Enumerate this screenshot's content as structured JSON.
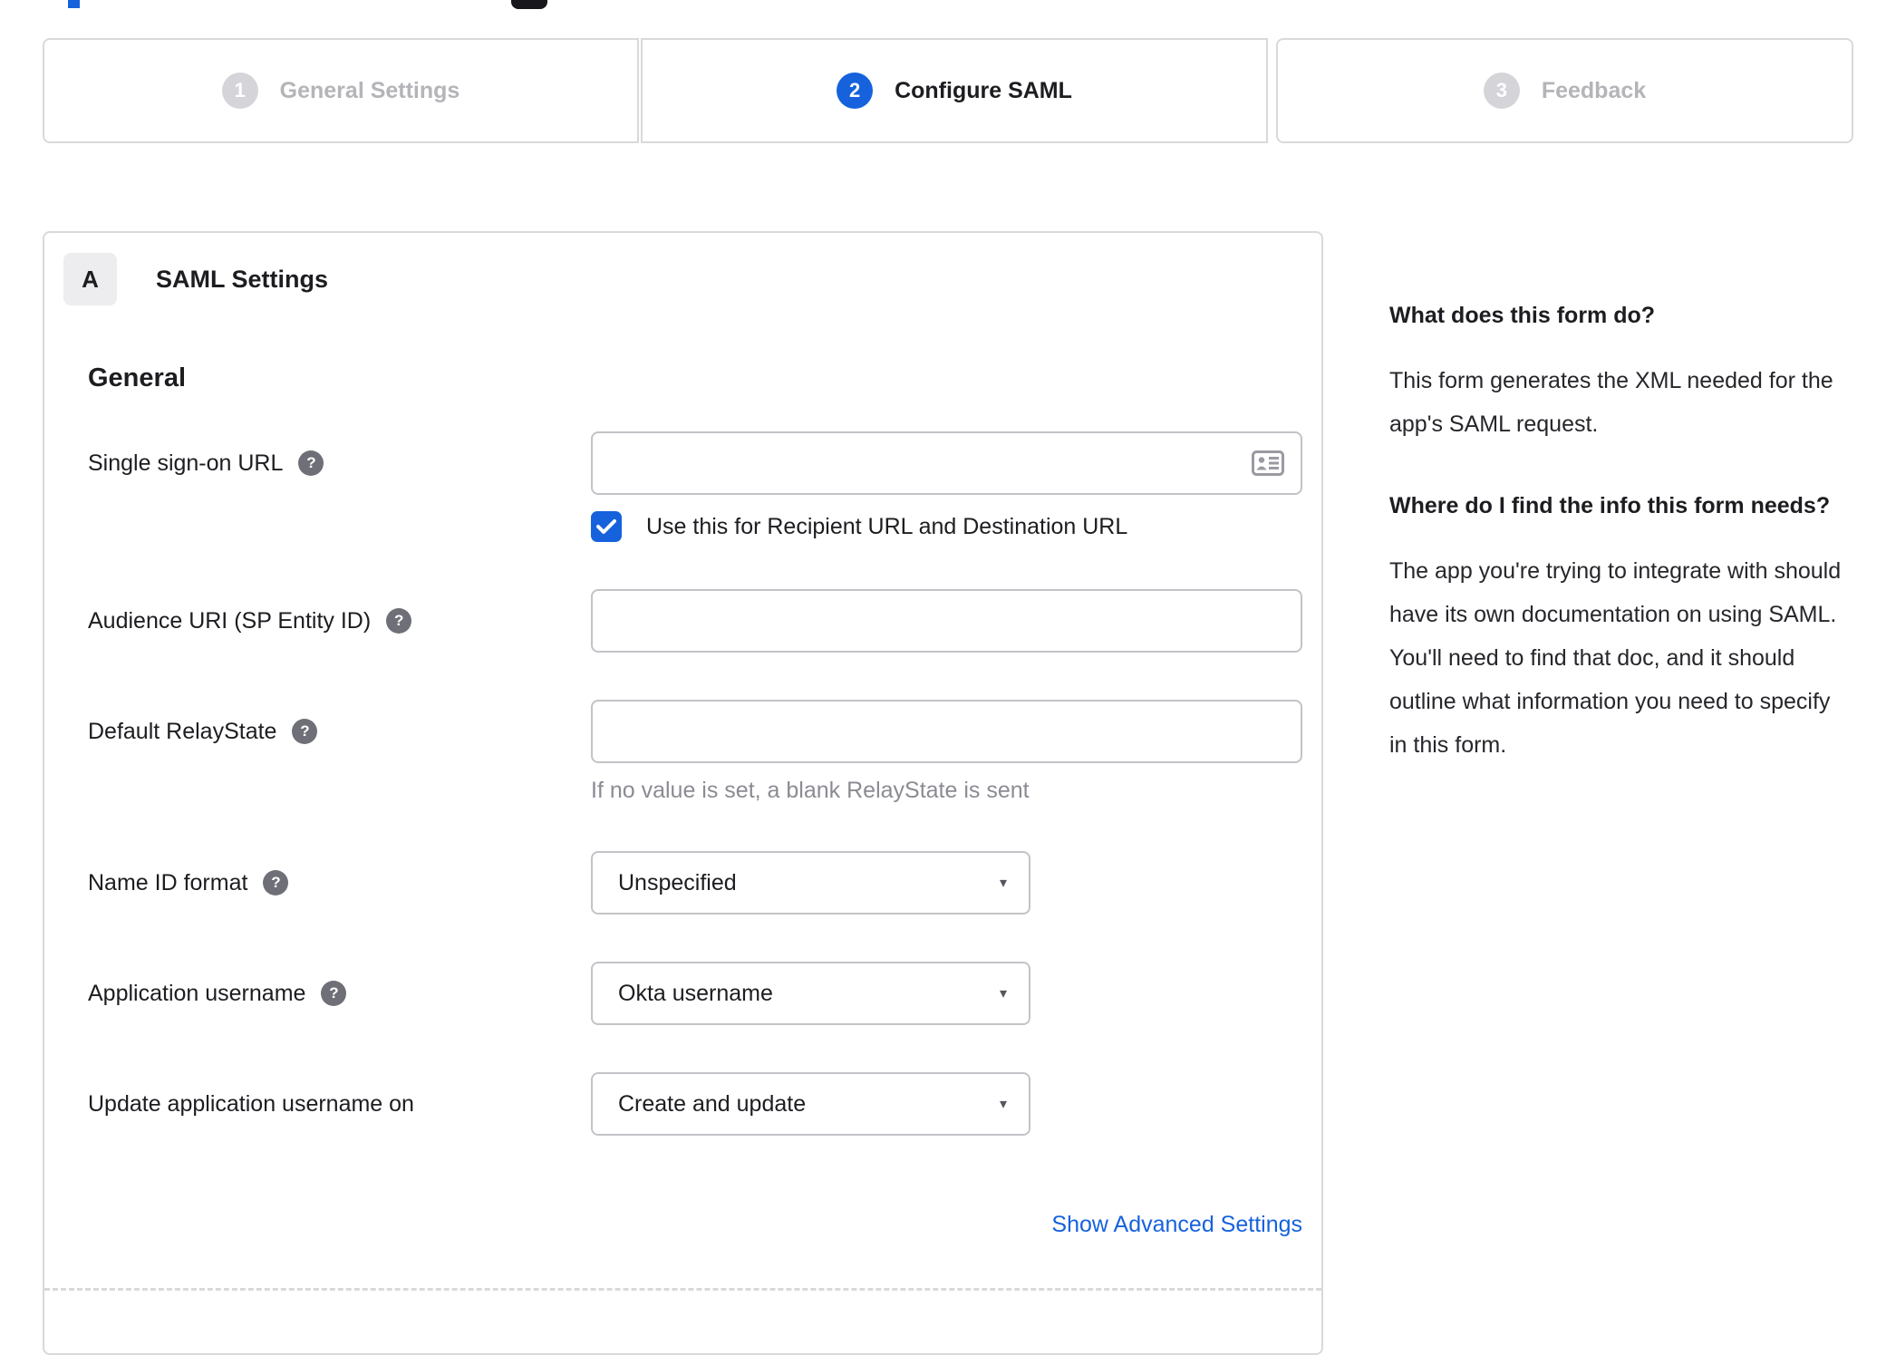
{
  "colors": {
    "accent_blue": "#1662dd",
    "inactive_gray": "#d5d5d9",
    "border_gray": "#d9d9dc",
    "text_dark": "#1d1d21",
    "hint_gray": "#8b8b94"
  },
  "icons": {
    "help_glyph": "?",
    "caret_glyph": "▾"
  },
  "stepper": {
    "steps": [
      {
        "number": "1",
        "label": "General Settings",
        "state": "inactive"
      },
      {
        "number": "2",
        "label": "Configure SAML",
        "state": "active"
      },
      {
        "number": "3",
        "label": "Feedback",
        "state": "inactive"
      }
    ]
  },
  "panel": {
    "badge": "A",
    "title": "SAML Settings",
    "section_heading": "General",
    "fields": {
      "sso": {
        "label": "Single sign-on URL",
        "value": "",
        "checkbox_label": "Use this for Recipient URL and Destination URL",
        "checkbox_checked": true
      },
      "audience": {
        "label": "Audience URI (SP Entity ID)",
        "value": ""
      },
      "relay": {
        "label": "Default RelayState",
        "value": "",
        "hint": "If no value is set, a blank RelayState is sent"
      },
      "nameid": {
        "label": "Name ID format",
        "value": "Unspecified"
      },
      "appuser": {
        "label": "Application username",
        "value": "Okta username"
      },
      "updateuser": {
        "label": "Update application username on",
        "value": "Create and update"
      }
    },
    "advanced_link": "Show Advanced Settings"
  },
  "help": {
    "q1": "What does this form do?",
    "a1": "This form generates the XML needed for the app's SAML request.",
    "q2": "Where do I find the info this form needs?",
    "a2": "The app you're trying to integrate with should have its own documentation on using SAML. You'll need to find that doc, and it should outline what information you need to specify in this form."
  }
}
